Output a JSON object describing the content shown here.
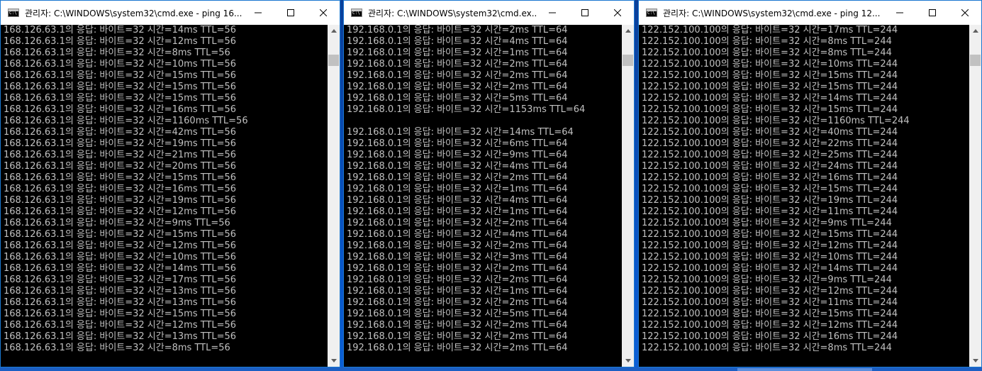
{
  "windows": [
    {
      "title": "관리자: C:\\WINDOWS\\system32\\cmd.exe - ping  16...",
      "lines": [
        "168.126.63.1의 응답: 바이트=32 시간=14ms TTL=56",
        "168.126.63.1의 응답: 바이트=32 시간=12ms TTL=56",
        "168.126.63.1의 응답: 바이트=32 시간=8ms TTL=56",
        "168.126.63.1의 응답: 바이트=32 시간=10ms TTL=56",
        "168.126.63.1의 응답: 바이트=32 시간=15ms TTL=56",
        "168.126.63.1의 응답: 바이트=32 시간=15ms TTL=56",
        "168.126.63.1의 응답: 바이트=32 시간=15ms TTL=56",
        "168.126.63.1의 응답: 바이트=32 시간=16ms TTL=56",
        "168.126.63.1의 응답: 바이트=32 시간=1160ms TTL=56",
        "168.126.63.1의 응답: 바이트=32 시간=42ms TTL=56",
        "168.126.63.1의 응답: 바이트=32 시간=19ms TTL=56",
        "168.126.63.1의 응답: 바이트=32 시간=21ms TTL=56",
        "168.126.63.1의 응답: 바이트=32 시간=20ms TTL=56",
        "168.126.63.1의 응답: 바이트=32 시간=15ms TTL=56",
        "168.126.63.1의 응답: 바이트=32 시간=16ms TTL=56",
        "168.126.63.1의 응답: 바이트=32 시간=19ms TTL=56",
        "168.126.63.1의 응답: 바이트=32 시간=12ms TTL=56",
        "168.126.63.1의 응답: 바이트=32 시간=9ms TTL=56",
        "168.126.63.1의 응답: 바이트=32 시간=15ms TTL=56",
        "168.126.63.1의 응답: 바이트=32 시간=12ms TTL=56",
        "168.126.63.1의 응답: 바이트=32 시간=10ms TTL=56",
        "168.126.63.1의 응답: 바이트=32 시간=14ms TTL=56",
        "168.126.63.1의 응답: 바이트=32 시간=17ms TTL=56",
        "168.126.63.1의 응답: 바이트=32 시간=13ms TTL=56",
        "168.126.63.1의 응답: 바이트=32 시간=13ms TTL=56",
        "168.126.63.1의 응답: 바이트=32 시간=15ms TTL=56",
        "168.126.63.1의 응답: 바이트=32 시간=12ms TTL=56",
        "168.126.63.1의 응답: 바이트=32 시간=13ms TTL=56",
        "168.126.63.1의 응답: 바이트=32 시간=8ms TTL=56"
      ]
    },
    {
      "title": "관리자: C:\\WINDOWS\\system32\\cmd.ex...",
      "lines": [
        "192.168.0.1의 응답: 바이트=32 시간=2ms TTL=64",
        "192.168.0.1의 응답: 바이트=32 시간=4ms TTL=64",
        "192.168.0.1의 응답: 바이트=32 시간=1ms TTL=64",
        "192.168.0.1의 응답: 바이트=32 시간=2ms TTL=64",
        "192.168.0.1의 응답: 바이트=32 시간=2ms TTL=64",
        "192.168.0.1의 응답: 바이트=32 시간=2ms TTL=64",
        "192.168.0.1의 응답: 바이트=32 시간=5ms TTL=64",
        "192.168.0.1의 응답: 바이트=32 시간=1153ms TTL=64",
        "",
        "192.168.0.1의 응답: 바이트=32 시간=14ms TTL=64",
        "192.168.0.1의 응답: 바이트=32 시간=6ms TTL=64",
        "192.168.0.1의 응답: 바이트=32 시간=9ms TTL=64",
        "192.168.0.1의 응답: 바이트=32 시간=4ms TTL=64",
        "192.168.0.1의 응답: 바이트=32 시간=2ms TTL=64",
        "192.168.0.1의 응답: 바이트=32 시간=1ms TTL=64",
        "192.168.0.1의 응답: 바이트=32 시간=4ms TTL=64",
        "192.168.0.1의 응답: 바이트=32 시간=1ms TTL=64",
        "192.168.0.1의 응답: 바이트=32 시간=2ms TTL=64",
        "192.168.0.1의 응답: 바이트=32 시간=4ms TTL=64",
        "192.168.0.1의 응답: 바이트=32 시간=2ms TTL=64",
        "192.168.0.1의 응답: 바이트=32 시간=3ms TTL=64",
        "192.168.0.1의 응답: 바이트=32 시간=2ms TTL=64",
        "192.168.0.1의 응답: 바이트=32 시간=2ms TTL=64",
        "192.168.0.1의 응답: 바이트=32 시간=1ms TTL=64",
        "192.168.0.1의 응답: 바이트=32 시간=2ms TTL=64",
        "192.168.0.1의 응답: 바이트=32 시간=5ms TTL=64",
        "192.168.0.1의 응답: 바이트=32 시간=2ms TTL=64",
        "192.168.0.1의 응답: 바이트=32 시간=2ms TTL=64",
        "192.168.0.1의 응답: 바이트=32 시간=2ms TTL=64"
      ]
    },
    {
      "title": "관리자: C:\\WINDOWS\\system32\\cmd.exe - ping  12...",
      "lines": [
        "122.152.100.100의 응답: 바이트=32 시간=17ms TTL=244",
        "122.152.100.100의 응답: 바이트=32 시간=8ms TTL=244",
        "122.152.100.100의 응답: 바이트=32 시간=8ms TTL=244",
        "122.152.100.100의 응답: 바이트=32 시간=10ms TTL=244",
        "122.152.100.100의 응답: 바이트=32 시간=15ms TTL=244",
        "122.152.100.100의 응답: 바이트=32 시간=15ms TTL=244",
        "122.152.100.100의 응답: 바이트=32 시간=14ms TTL=244",
        "122.152.100.100의 응답: 바이트=32 시간=15ms TTL=244",
        "122.152.100.100의 응답: 바이트=32 시간=1160ms TTL=244",
        "122.152.100.100의 응답: 바이트=32 시간=40ms TTL=244",
        "122.152.100.100의 응답: 바이트=32 시간=22ms TTL=244",
        "122.152.100.100의 응답: 바이트=32 시간=25ms TTL=244",
        "122.152.100.100의 응답: 바이트=32 시간=24ms TTL=244",
        "122.152.100.100의 응답: 바이트=32 시간=16ms TTL=244",
        "122.152.100.100의 응답: 바이트=32 시간=15ms TTL=244",
        "122.152.100.100의 응답: 바이트=32 시간=19ms TTL=244",
        "122.152.100.100의 응답: 바이트=32 시간=11ms TTL=244",
        "122.152.100.100의 응답: 바이트=32 시간=9ms TTL=244",
        "122.152.100.100의 응답: 바이트=32 시간=15ms TTL=244",
        "122.152.100.100의 응답: 바이트=32 시간=12ms TTL=244",
        "122.152.100.100의 응답: 바이트=32 시간=10ms TTL=244",
        "122.152.100.100의 응답: 바이트=32 시간=14ms TTL=244",
        "122.152.100.100의 응답: 바이트=32 시간=9ms TTL=244",
        "122.152.100.100의 응답: 바이트=32 시간=12ms TTL=244",
        "122.152.100.100의 응답: 바이트=32 시간=11ms TTL=244",
        "122.152.100.100의 응답: 바이트=32 시간=15ms TTL=244",
        "122.152.100.100의 응답: 바이트=32 시간=12ms TTL=244",
        "122.152.100.100의 응답: 바이트=32 시간=16ms TTL=244",
        "122.152.100.100의 응답: 바이트=32 시간=8ms TTL=244"
      ]
    }
  ],
  "icons": {
    "app": "cmd-icon",
    "minimize": "minimize-icon",
    "maximize": "maximize-icon",
    "close": "close-icon",
    "scroll_up": "scroll-up-arrow-icon",
    "scroll_down": "scroll-down-arrow-icon"
  },
  "colors": {
    "console_background": "#000000",
    "console_text": "#c0c0c0",
    "titlebar": "#ffffff",
    "window_border": "#1a77d0",
    "desktop": "#0a56c9"
  }
}
